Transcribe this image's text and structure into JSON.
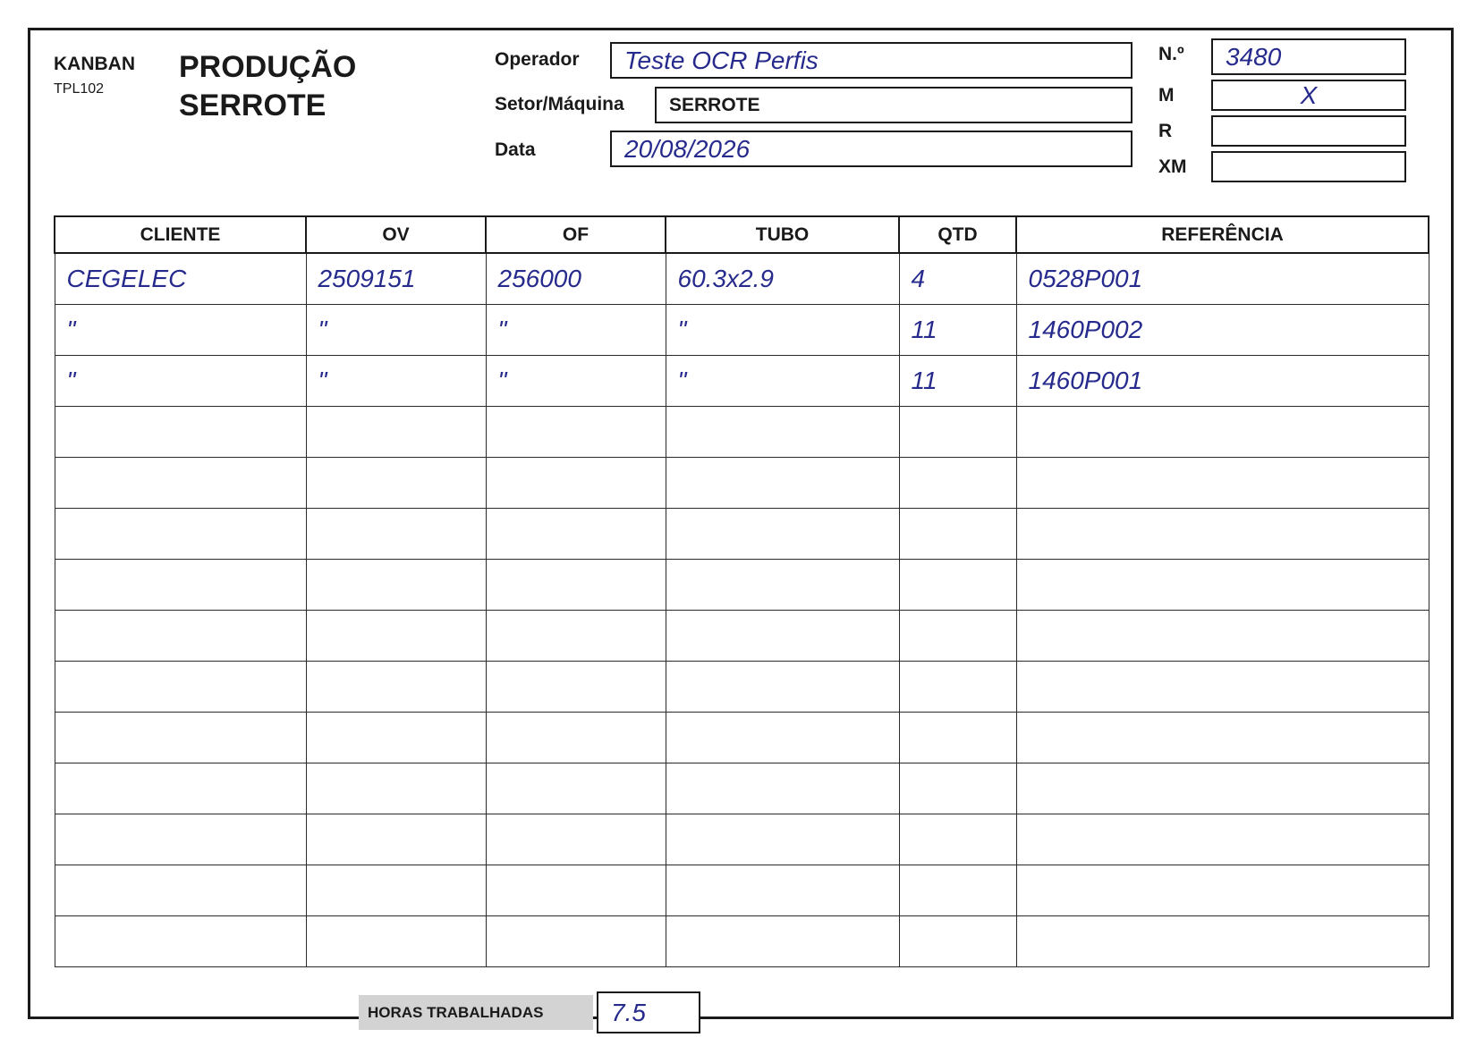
{
  "header": {
    "kanban": "KANBAN",
    "code": "TPL102",
    "title_line1": "PRODUÇÃO",
    "title_line2": "SERROTE"
  },
  "fields": {
    "operador_label": "Operador",
    "operador_value": "Teste OCR Perfis",
    "setor_label": "Setor/Máquina",
    "setor_value": "SERROTE",
    "data_label": "Data",
    "data_value": "20/08/2026"
  },
  "side_fields": {
    "numero_label": "N.º",
    "numero_value": "3480",
    "m_label": "M",
    "m_value": "X",
    "r_label": "R",
    "r_value": "",
    "xm_label": "XM",
    "xm_value": ""
  },
  "table": {
    "headers": [
      "CLIENTE",
      "OV",
      "OF",
      "TUBO",
      "QTD",
      "REFERÊNCIA"
    ],
    "rows": [
      [
        "CEGELEC",
        "2509151",
        "256000",
        "60.3x2.9",
        "4",
        "0528P001"
      ],
      [
        "\"",
        "\"",
        "\"",
        "\"",
        "11",
        "1460P002"
      ],
      [
        "\"",
        "\"",
        "\"",
        "\"",
        "11",
        "1460P001"
      ],
      [
        "",
        "",
        "",
        "",
        "",
        ""
      ],
      [
        "",
        "",
        "",
        "",
        "",
        ""
      ],
      [
        "",
        "",
        "",
        "",
        "",
        ""
      ],
      [
        "",
        "",
        "",
        "",
        "",
        ""
      ],
      [
        "",
        "",
        "",
        "",
        "",
        ""
      ],
      [
        "",
        "",
        "",
        "",
        "",
        ""
      ],
      [
        "",
        "",
        "",
        "",
        "",
        ""
      ],
      [
        "",
        "",
        "",
        "",
        "",
        ""
      ],
      [
        "",
        "",
        "",
        "",
        "",
        ""
      ],
      [
        "",
        "",
        "",
        "",
        "",
        ""
      ],
      [
        "",
        "",
        "",
        "",
        "",
        ""
      ]
    ]
  },
  "footer": {
    "horas_label": "HORAS TRABALHADAS",
    "horas_value": "7.5"
  },
  "colors": {
    "handwriting": "#262a8c",
    "ink": "#1a1a1a",
    "label_bg": "#d3d3d3"
  }
}
